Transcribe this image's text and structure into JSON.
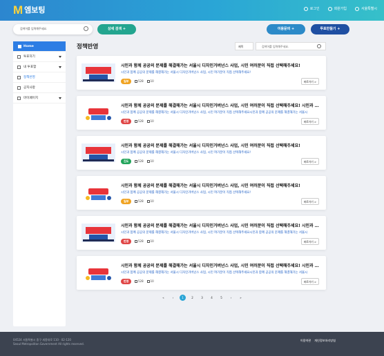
{
  "header": {
    "logo_mark": "M",
    "logo_text": "엠보팅",
    "links": [
      {
        "label": "로그인",
        "icon": "lock-icon"
      },
      {
        "label": "회원가입",
        "icon": "user-icon"
      },
      {
        "label": "서울특별시",
        "icon": "seal-icon"
      }
    ]
  },
  "search": {
    "placeholder": "검색어를 입력해주세요.",
    "detail_label": "상세 검색 +",
    "vote_label": "이용문의 +",
    "make_label": "투표만들기 +"
  },
  "sidebar": {
    "items": [
      {
        "label": "Home",
        "active": true
      },
      {
        "label": "투표하기",
        "has_arrow": true
      },
      {
        "label": "내 투표함",
        "has_arrow": true
      },
      {
        "label": "정책반영",
        "has_arrow": false
      },
      {
        "label": "공지사항",
        "has_arrow": false
      },
      {
        "label": "마이페이지",
        "has_arrow": true
      }
    ]
  },
  "main": {
    "title": "정책반영",
    "sort_value": "제목",
    "search_placeholder": "검색어를 입력해주세요."
  },
  "cards": [
    {
      "title": "시민과 함께 공공의 문제를 해결해가는 서울시 디자인거버넌스 사업, 시민 여러분이 직접 선택해주세요!",
      "subtitle": "시민과 함께 공공의 문제를 해결해가는 서울시 디자인거버넌스 사업, 시민 여가분이 직접 선택해주세요!",
      "badge": "일부",
      "badge_color": "#f0a322",
      "views": "528",
      "comments": "10",
      "more": "바로가기 >",
      "thumb": "a"
    },
    {
      "title": "시민과 함께 공공의 문제를 해결해가는 서울시 디자인거버넌스 사업, 시민 여러분이 직접 선택해주세요! 시민과 함께",
      "subtitle": "시민과 함께 공공의 문제를 해결해가는 서울시 디자인거버넌스 사업, 시민 여가분이 직접 선택해주세요시민과 함께 공공의 문제를 해결해가는 서울시",
      "badge": "반영",
      "badge_color": "#e04646",
      "views": "528",
      "comments": "10",
      "more": "바로가기 >",
      "thumb": "b"
    },
    {
      "title": "시민과 함께 공공의 문제를 해결해가는 서울시 디자인거버넌스 사업, 시민 여러분이 직접 선택해주세요!",
      "subtitle": "시민과 함께 공공의 문제를 해결해가는 서울시 디자인거버넌스 사업, 시민 여가분이 직접 선택해주세요!",
      "badge": "진도",
      "badge_color": "#22a45b",
      "views": "528",
      "comments": "10",
      "more": "바로가기 >",
      "thumb": "a"
    },
    {
      "title": "시민과 함께 공공의 문제를 해결해가는 서울시 디자인거버넌스 사업, 시민 여러분이 직접 선택해주세요!",
      "subtitle": "시민과 함께 공공의 문제를 해결해가는 서울시 디자인거버넌스 사업, 시민 여가분이 직접 선택해주세요!",
      "badge": "일부",
      "badge_color": "#f0a322",
      "views": "528",
      "comments": "10",
      "more": "바로가기 >",
      "thumb": "b"
    },
    {
      "title": "시민과 함께 공공의 문제를 해결해가는 서울시 디자인거버넌스 사업, 시민 여러분이 직접 선택해주세요! 시민과 함께",
      "subtitle": "시민과 함께 공공의 문제를 해결해가는 서울시 디자인거버넌스 사업, 시민 여가분이 직접 선택해주세요시민과 함께 공공의 문제를 해결해가는 서울시",
      "badge": "반영",
      "badge_color": "#e04646",
      "views": "528",
      "comments": "10",
      "more": "바로가기 >",
      "thumb": "a"
    },
    {
      "title": "시민과 함께 공공의 문제를 해결해가는 서울시 디자인거버넌스 사업, 시민 여러분이 직접 선택해주세요! 시민과 함께",
      "subtitle": "시민과 함께 공공의 문제를 해결해가는 서울시 디자인거버넌스 사업, 시민 여가분이 직접 선택해주세요시민과 함께 공공의 문제를 해결해가는 서울시",
      "badge": "반영",
      "badge_color": "#e04646",
      "views": "528",
      "comments": "10",
      "more": "바로가기 >",
      "thumb": "b"
    }
  ],
  "pagination": {
    "items": [
      "«",
      "‹",
      "1",
      "2",
      "3",
      "4",
      "5",
      "›",
      "»"
    ],
    "active": "1"
  },
  "footer": {
    "address": "04524 서울특별시 중구 세종대로 110 · 02-120",
    "copyright": "Seoul Metropolitan Government All rights reserved.",
    "links": [
      "이용약관",
      "개인정보처리방침"
    ]
  },
  "colors": {
    "header_gradient_start": "#2c86cf",
    "header_gradient_end": "#36c0c9",
    "accent": "#2d7de4",
    "footer": "#3c4350"
  }
}
